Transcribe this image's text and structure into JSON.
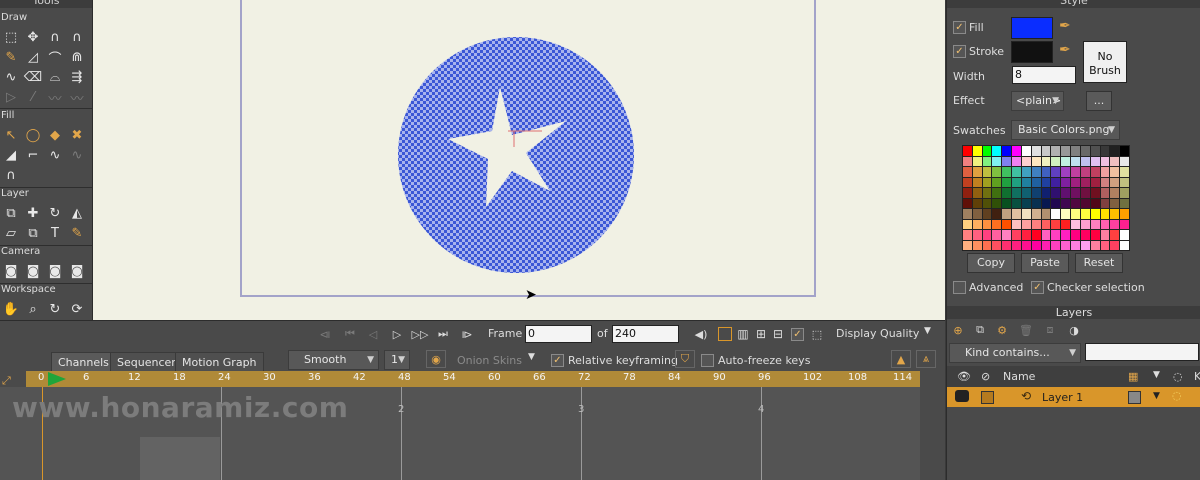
{
  "tools": {
    "title": "Tools",
    "sections": {
      "draw": "Draw",
      "fill": "Fill",
      "layer": "Layer",
      "camera": "Camera",
      "workspace": "Workspace"
    }
  },
  "transport": {
    "frame_label": "Frame",
    "frame_value": "0",
    "of_label": "of",
    "total_frames": "240",
    "display_quality": "Display Quality"
  },
  "timeline": {
    "tabs": [
      "Channels",
      "Sequencer",
      "Motion Graph"
    ],
    "interpolation": "Smooth",
    "interp_count": "1",
    "onion_skins": "Onion Skins",
    "relative_keyframing": "Relative keyframing",
    "auto_freeze": "Auto-freeze keys",
    "ruler_ticks": [
      "0",
      "6",
      "12",
      "18",
      "24",
      "30",
      "36",
      "42",
      "48",
      "54",
      "60",
      "66",
      "72",
      "78",
      "84",
      "90",
      "96",
      "102",
      "108",
      "114"
    ],
    "second_markers": [
      "2",
      "3",
      "4"
    ],
    "watermark": "www.honaramiz.com"
  },
  "style": {
    "title": "Style",
    "fill_label": "Fill",
    "fill_color": "#0a2dff",
    "stroke_label": "Stroke",
    "stroke_color": "#111111",
    "no_brush": "No Brush",
    "width_label": "Width",
    "width_value": "8",
    "effect_label": "Effect",
    "effect_value": "<plain>",
    "effect_more": "...",
    "swatches_label": "Swatches",
    "swatches_value": "Basic Colors.png",
    "copy_button": "Copy",
    "paste_button": "Paste",
    "reset_button": "Reset",
    "advanced_label": "Advanced",
    "checker_label": "Checker selection"
  },
  "layers": {
    "title": "Layers",
    "filter_value": "Kind contains...",
    "name_header": "Name",
    "layer_name": "Layer 1"
  },
  "colors": {
    "accent": "#d9962a",
    "circle_fill": "#3b57d6",
    "canvas_bg": "#f1f1e4"
  }
}
